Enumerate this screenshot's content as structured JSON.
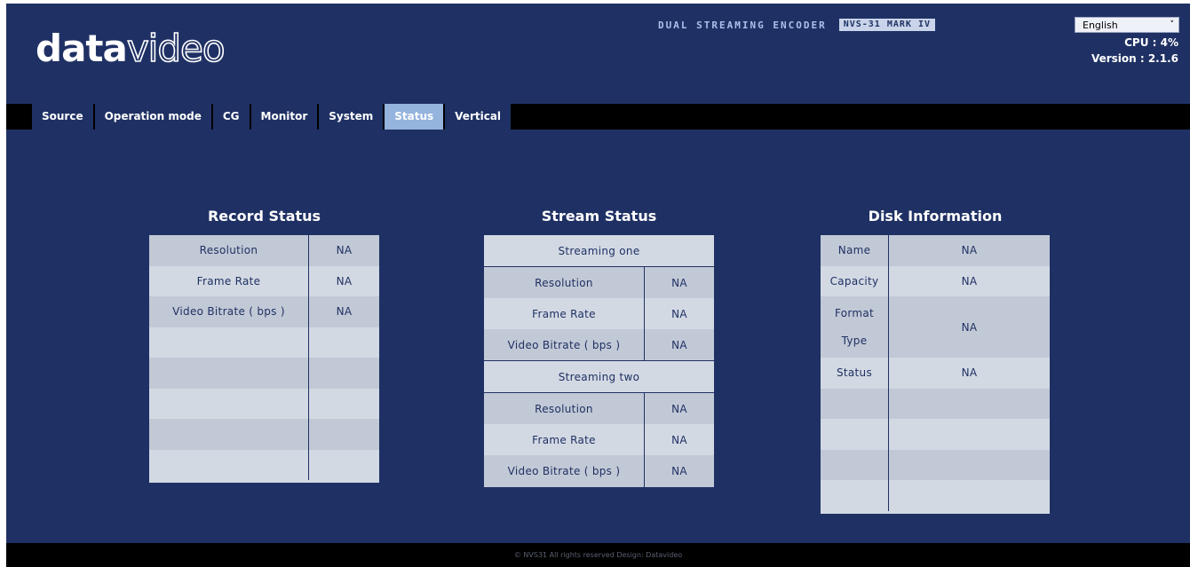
{
  "header": {
    "logo_bold": "data",
    "logo_light": "video",
    "product_name": "DUAL STREAMING ENCODER",
    "product_model": "NVS-31 MARK IV",
    "language": "English",
    "cpu_text": "CPU : 4%",
    "version_text": "Version : 2.1.6"
  },
  "nav": {
    "tabs": [
      "Source",
      "Operation mode",
      "CG",
      "Monitor",
      "System",
      "Status",
      "Vertical"
    ],
    "active": "Status"
  },
  "record": {
    "title": "Record Status",
    "rows": [
      {
        "label": "Resolution",
        "value": "NA"
      },
      {
        "label": "Frame Rate",
        "value": "NA"
      },
      {
        "label": "Video Bitrate ( bps )",
        "value": "NA"
      }
    ]
  },
  "stream": {
    "title": "Stream Status",
    "one": {
      "header": "Streaming one",
      "rows": [
        {
          "label": "Resolution",
          "value": "NA"
        },
        {
          "label": "Frame Rate",
          "value": "NA"
        },
        {
          "label": "Video Bitrate ( bps )",
          "value": "NA"
        }
      ]
    },
    "two": {
      "header": "Streaming two",
      "rows": [
        {
          "label": "Resolution",
          "value": "NA"
        },
        {
          "label": "Frame Rate",
          "value": "NA"
        },
        {
          "label": "Video Bitrate ( bps )",
          "value": "NA"
        }
      ]
    }
  },
  "disk": {
    "title": "Disk Information",
    "name_label": "Name",
    "name_value": "NA",
    "capacity_label": "Capacity",
    "capacity_value": "NA",
    "format_label": "Format",
    "type_label": "Type",
    "format_value": "NA",
    "status_label": "Status",
    "status_value": "NA"
  },
  "footer": {
    "text": "© NVS31 All rights reserved Design: Datavideo"
  },
  "colors": {
    "background": "#1f3164",
    "nav_bar": "#000000",
    "active_tab": "#94b3dd",
    "table_light": "#d3d9e3",
    "table_dark": "#c2c9d6"
  }
}
